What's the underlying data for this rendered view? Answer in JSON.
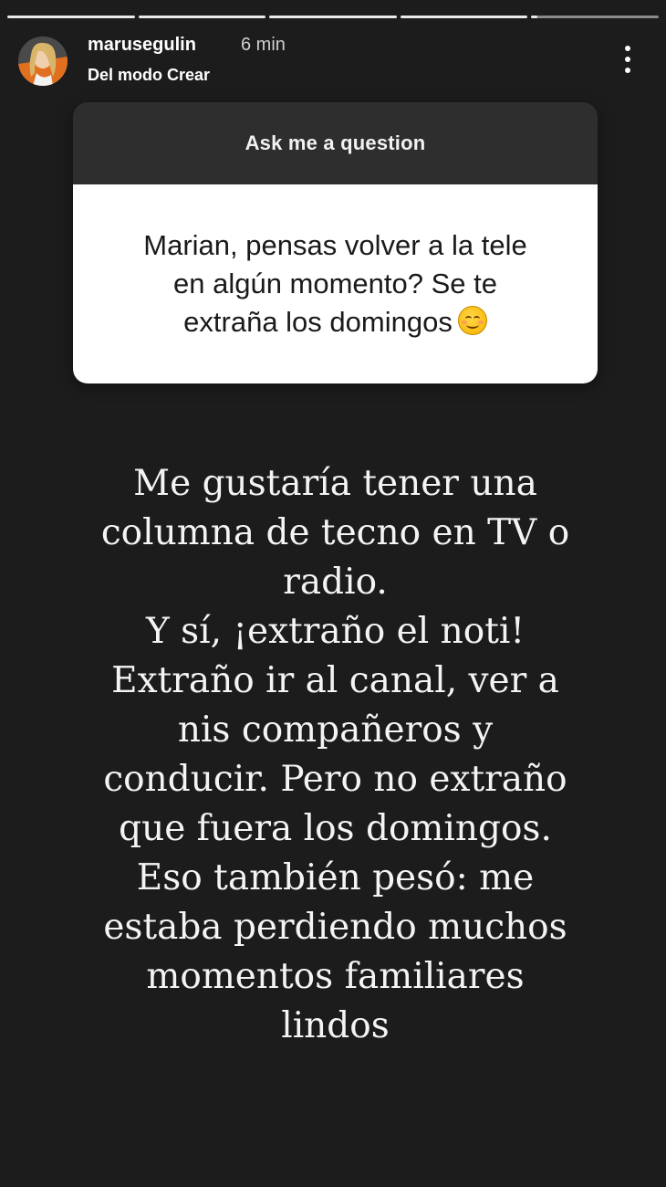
{
  "story": {
    "progress_segments": [
      {
        "state": "viewed"
      },
      {
        "state": "viewed"
      },
      {
        "state": "viewed"
      },
      {
        "state": "viewed"
      },
      {
        "state": "current"
      }
    ],
    "username": "marusegulin",
    "time_ago": "6 min",
    "subtitle": "Del modo Crear",
    "menu_icon": "more-vertical-icon"
  },
  "question_card": {
    "header": "Ask me a question",
    "question_lines": [
      "Marian, pensas volver a la tele",
      "en algún momento? Se te",
      "extraña los domingos"
    ],
    "emoji": "smiling-face-with-smiling-eyes"
  },
  "answer": {
    "lines": [
      "Me gustaría tener una",
      "columna de tecno en TV o",
      "radio.",
      "Y sí, ¡extraño el noti!",
      "Extraño ir al canal, ver a",
      "nis compañeros y",
      "conducir. Pero no extraño",
      "que fuera los domingos.",
      "Eso también pesó: me",
      "estaba perdiendo muchos",
      "momentos familiares",
      "lindos"
    ]
  },
  "colors": {
    "background": "#1c1c1c",
    "card_header": "#2e2e2e",
    "card_body": "#ffffff",
    "text_light": "#f4f4f4"
  }
}
